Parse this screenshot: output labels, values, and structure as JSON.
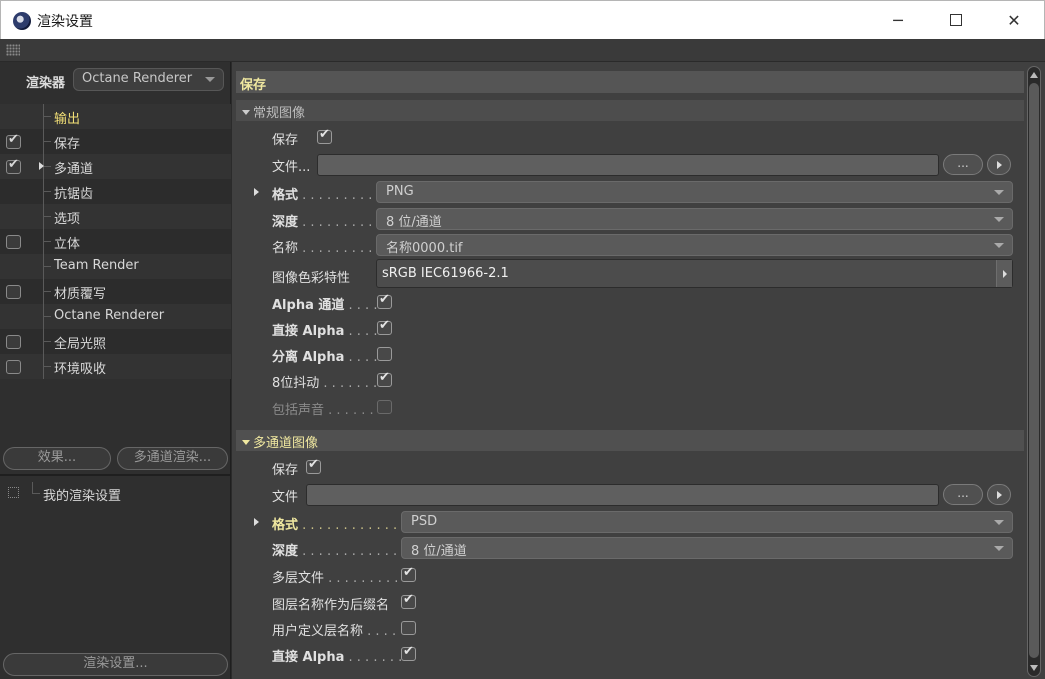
{
  "window": {
    "title": "渲染设置",
    "minimize": "─",
    "close": "✕"
  },
  "left": {
    "renderer_label": "渲染器",
    "renderer_value": "Octane Renderer",
    "tree": [
      {
        "label": "输出",
        "checkbox": null,
        "active": true,
        "expand": false
      },
      {
        "label": "保存",
        "checkbox": true,
        "active": false,
        "expand": false
      },
      {
        "label": "多通道",
        "checkbox": true,
        "active": false,
        "expand": true
      },
      {
        "label": "抗锯齿",
        "checkbox": null,
        "active": false,
        "expand": false
      },
      {
        "label": "选项",
        "checkbox": null,
        "active": false,
        "expand": false
      },
      {
        "label": "立体",
        "checkbox": false,
        "active": false,
        "expand": false
      },
      {
        "label": "Team Render",
        "checkbox": null,
        "active": false,
        "expand": false
      },
      {
        "label": "材质覆写",
        "checkbox": false,
        "active": false,
        "expand": false
      },
      {
        "label": "Octane Renderer",
        "checkbox": null,
        "active": false,
        "expand": false
      },
      {
        "label": "全局光照",
        "checkbox": false,
        "active": false,
        "expand": false
      },
      {
        "label": "环境吸收",
        "checkbox": false,
        "active": false,
        "expand": false
      }
    ],
    "effects_button": "效果...",
    "multipass_button": "多通道渲染...",
    "preset_label": "我的渲染设置",
    "render_settings_button": "渲染设置..."
  },
  "main": {
    "section_title": "保存",
    "regular": {
      "header": "常规图像",
      "save_label": "保存",
      "save_checked": true,
      "file_label": "文件...",
      "dots": "...",
      "format_label": "格式",
      "format_dots": " . . . . . . . . . .",
      "format_value": "PNG",
      "depth_label": "深度",
      "depth_dots": " . . . . . . . . . .",
      "depth_value": "8 位/通道",
      "name_label": "名称",
      "name_dots": " . . . . . . . . . .",
      "name_value": "名称0000.tif",
      "colorprofile_label": "图像色彩特性",
      "colorprofile_value": "sRGB IEC61966-2.1",
      "alpha_label": "Alpha 通道",
      "alpha_dots": " . . . .",
      "alpha_checked": true,
      "straight_alpha_label": "直接 Alpha",
      "straight_alpha_dots": " . . . .",
      "straight_alpha_checked": true,
      "separate_alpha_label": "分离 Alpha",
      "separate_alpha_dots": " . . . .",
      "separate_alpha_checked": false,
      "dither_label": "8位抖动",
      "dither_dots": " . . . . . . .",
      "dither_checked": true,
      "sound_label": "包括声音",
      "sound_dots": " . . . . . .",
      "sound_checked": false
    },
    "multipass": {
      "header": "多通道图像",
      "save_label": "保存",
      "save_checked": true,
      "file_label": "文件",
      "dots": "...",
      "format_label": "格式",
      "format_dots": " . . . . . . . . . . . . .",
      "format_value": "PSD",
      "depth_label": "深度",
      "depth_dots": " . . . . . . . . . . . . .",
      "depth_value": "8 位/通道",
      "multilayer_label": "多层文件",
      "multilayer_dots": " . . . . . . . . .",
      "multilayer_checked": true,
      "layername_suffix_label": "图层名称作为后缀名",
      "layername_suffix_checked": true,
      "userdefined_label": "用户定义层名称",
      "userdefined_dots": " . . . .",
      "userdefined_checked": false,
      "straight_alpha_label": "直接 Alpha",
      "straight_alpha_dots": " . . . . . . .",
      "straight_alpha_checked": true
    }
  }
}
